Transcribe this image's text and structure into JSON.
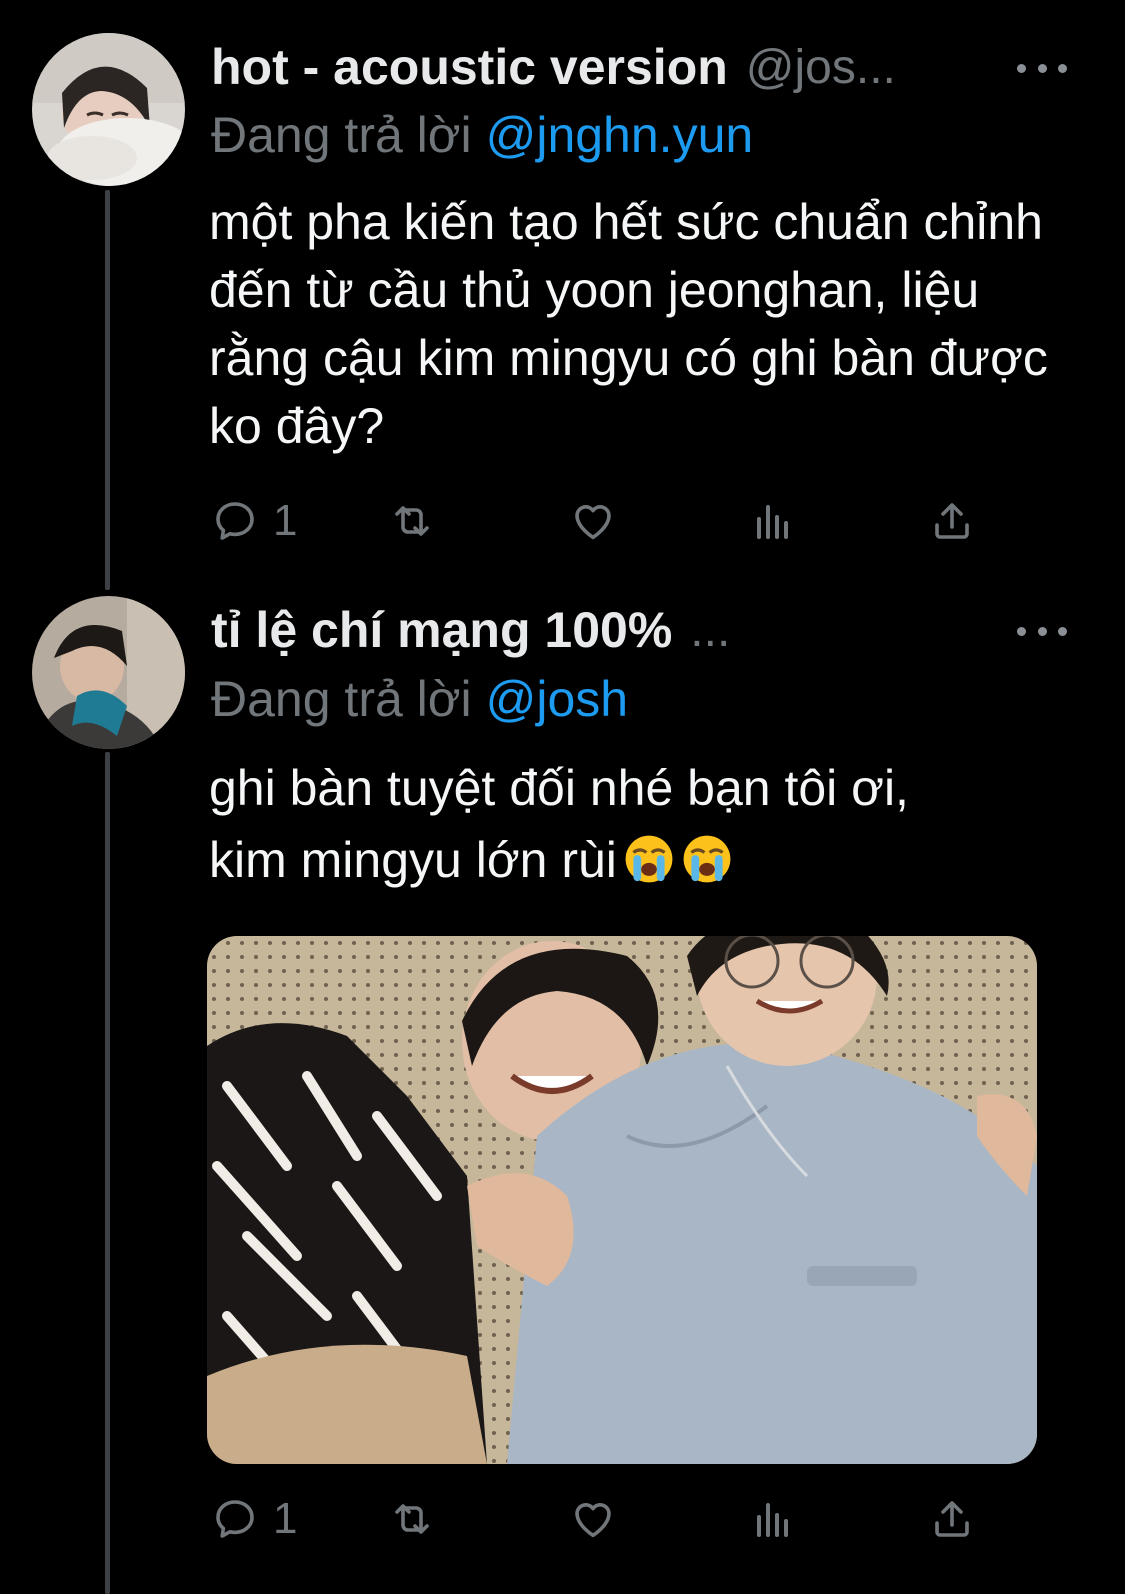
{
  "tweets": [
    {
      "display_name": "hot - acoustic version",
      "handle": "@jos...",
      "replying_label": "Đang trả lời",
      "replying_to": "@jnghn.yun",
      "text": "một pha kiến tạo hết sức chuẩn chỉnh đến từ cầu thủ yoon jeonghan, liệu rằng cậu kim mingyu có ghi bàn được ko đây?",
      "reply_count": "1",
      "icons": [
        "reply-icon",
        "retweet-icon",
        "like-icon",
        "analytics-icon",
        "share-icon"
      ]
    },
    {
      "display_name": "tỉ lệ chí mạng 100%",
      "handle": "...",
      "replying_label": "Đang trả lời",
      "replying_to": "@josh",
      "text_line1": "ghi bàn tuyệt đối nhé bạn tôi ơi,",
      "text_line2": "kim mingyu lớn rùi",
      "emoji": [
        "loudly-crying-face",
        "loudly-crying-face"
      ],
      "reply_count": "1",
      "has_media": true,
      "icons": [
        "reply-icon",
        "retweet-icon",
        "like-icon",
        "analytics-icon",
        "share-icon"
      ]
    }
  ],
  "colors": {
    "background": "#000000",
    "text": "#e7e9ea",
    "secondary": "#71767b",
    "accent": "#1d9bf0",
    "thread_line": "#3d4145"
  }
}
